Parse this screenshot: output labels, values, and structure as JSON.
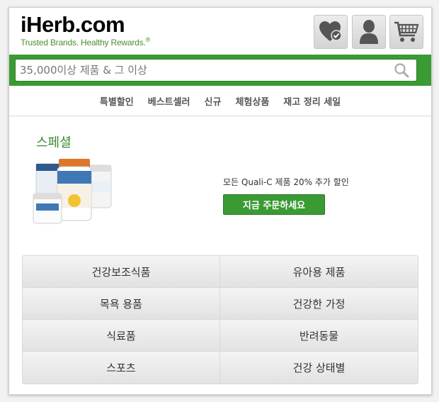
{
  "header": {
    "logo_text": "iHerb.com",
    "logo_tagline": "Trusted Brands. Healthy Rewards.",
    "icons": [
      "heart-check-icon",
      "user-icon",
      "cart-icon"
    ]
  },
  "search": {
    "placeholder": "35,000이상 제품 & 그 이상"
  },
  "nav": {
    "items": [
      "특별할인",
      "베스트셀러",
      "신규",
      "체험상품",
      "재고 정리 세일"
    ]
  },
  "special": {
    "title": "스페셜",
    "promo_text": "모든 Quali-C 제품 20% 추가 할인",
    "button_label": "지금 주문하세요"
  },
  "categories": [
    "건강보조식품",
    "유아용 제품",
    "목욕 용품",
    "건강한 가정",
    "식료품",
    "반려동물",
    "스포츠",
    "건강 상태별"
  ],
  "colors": {
    "brand_green": "#3a9a33",
    "logo_green": "#4a8f2a"
  }
}
